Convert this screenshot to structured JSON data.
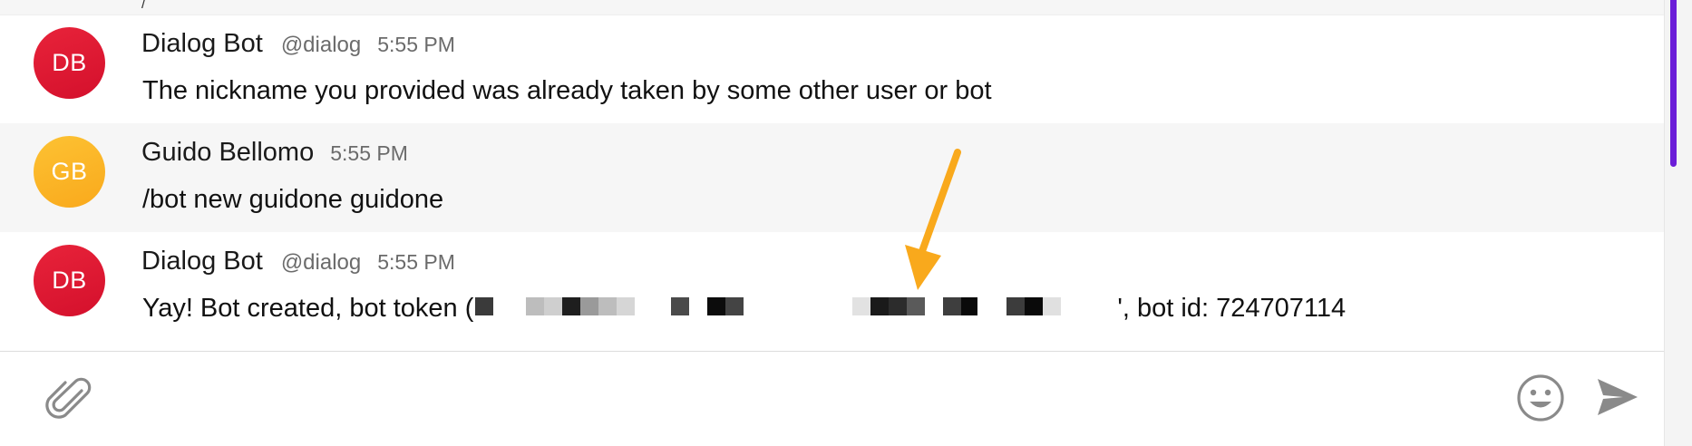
{
  "previous_message_fragment": "/",
  "messages": [
    {
      "initials": "DB",
      "sender": "Dialog Bot",
      "handle": "@dialog",
      "time": "5:55 PM",
      "text": "The nickname you provided was already taken by some other user or bot",
      "avatar_color": "#e01a35"
    },
    {
      "initials": "GB",
      "sender": "Guido Bellomo",
      "time": "5:55 PM",
      "text": "/bot new guidone guidone",
      "avatar_color": "#fbb526"
    },
    {
      "initials": "DB",
      "sender": "Dialog Bot",
      "handle": "@dialog",
      "time": "5:55 PM",
      "text_prefix": "Yay! Bot created, bot token (",
      "text_suffix": "', bot id: 724707114",
      "avatar_color": "#e01a35"
    }
  ],
  "composer": {
    "placeholder": ""
  },
  "icons": {
    "attach": "paperclip-icon",
    "emoji": "smiley-icon",
    "send": "send-icon"
  },
  "colors": {
    "accent": "#6c1ed8",
    "annotation_arrow": "#f9a91c"
  }
}
